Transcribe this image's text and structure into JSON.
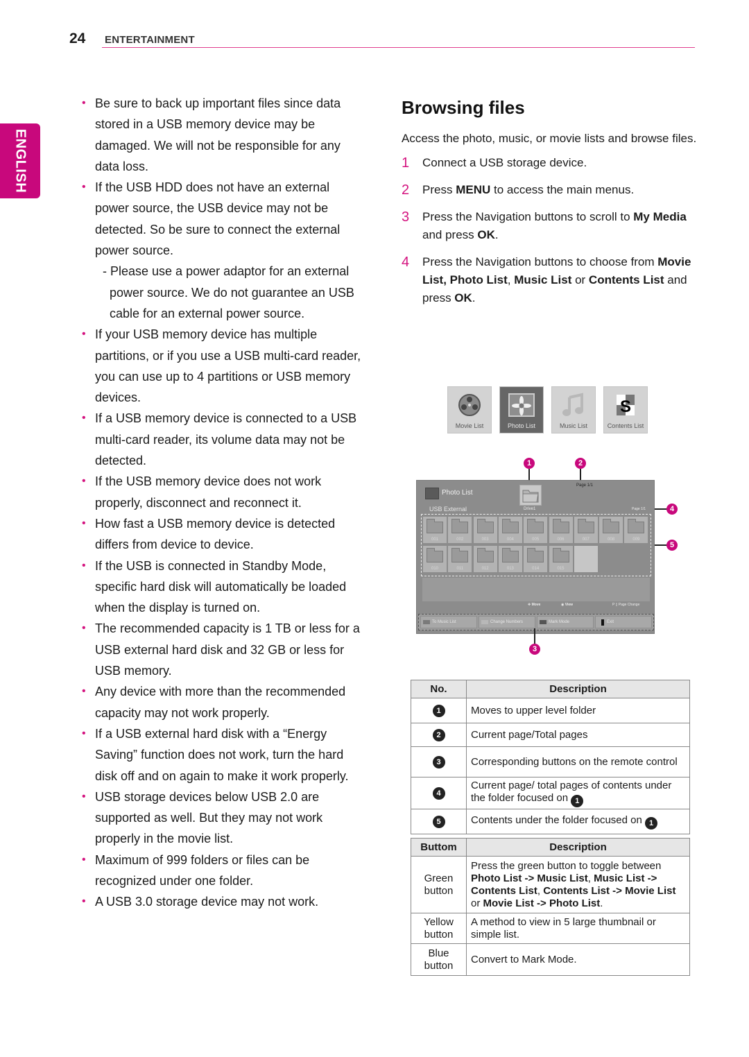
{
  "header": {
    "page_number": "24",
    "section": "ENTERTAINMENT"
  },
  "language_tab": "ENGLISH",
  "notes": [
    "Be sure to back up important files since data stored in a USB memory device may be damaged. We will not be responsible for any data loss.",
    "If the USB HDD does not have an external power source, the USB device may not be detected. So be sure to connect the external power source.",
    "If your USB memory device has multiple partitions, or if you use a USB multi-card reader, you can use up to 4 partitions or USB memory devices.",
    "If a USB memory device is connected to a USB multi-card reader, its volume data may not be detected.",
    "If the USB memory device does not work properly, disconnect and reconnect it.",
    "How fast a USB memory device is detected differs from device to device.",
    "If the USB is connected in Standby Mode, specific hard disk will automatically be loaded when the display is turned on.",
    "The recommended capacity is 1 TB or less for a USB external hard disk and 32 GB or less for USB memory.",
    "Any device with more than the recommended capacity may not work properly.",
    "If a USB external hard disk with a “Energy Saving” function does not work, turn the hard disk off and on again to make it work properly.",
    "USB storage devices below USB 2.0 are supported as well. But they may not work properly in the movie list.",
    "Maximum of 999 folders or files can be recognized under one folder.",
    "A USB 3.0 storage device may not work."
  ],
  "sub_note": "- Please use a power adaptor for an external power source. We do not guarantee an USB cable for an external power source.",
  "section_title": "Browsing files",
  "intro": "Access the photo, music, or movie lists and browse files.",
  "steps": [
    {
      "num": "1",
      "parts": [
        [
          "Connect a USB storage device.",
          false
        ]
      ]
    },
    {
      "num": "2",
      "parts": [
        [
          "Press ",
          false
        ],
        [
          "MENU",
          true
        ],
        [
          " to access the main menus.",
          false
        ]
      ]
    },
    {
      "num": "3",
      "parts": [
        [
          "Press the Navigation buttons to scroll to ",
          false
        ],
        [
          "My Media",
          true
        ],
        [
          " and press ",
          false
        ],
        [
          "OK",
          true
        ],
        [
          ".",
          false
        ]
      ]
    },
    {
      "num": "4",
      "parts": [
        [
          "Press the Navigation buttons to choose from ",
          false
        ],
        [
          "Movie List, Photo List",
          true
        ],
        [
          ", ",
          false
        ],
        [
          "Music List",
          true
        ],
        [
          " or ",
          false
        ],
        [
          "Contents List",
          true
        ],
        [
          " and press ",
          false
        ],
        [
          "OK",
          true
        ],
        [
          ".",
          false
        ]
      ]
    }
  ],
  "media_menu": [
    {
      "label": "Movie List",
      "icon": "film-reel-icon",
      "active": false
    },
    {
      "label": "Photo List",
      "icon": "photo-flower-icon",
      "active": true
    },
    {
      "label": "Music List",
      "icon": "music-note-icon",
      "active": false
    },
    {
      "label": "Contents List",
      "icon": "contents-s-icon",
      "active": false
    }
  ],
  "screen": {
    "title": "Photo List",
    "source": "USB External",
    "drive": "Drive1",
    "page_top": "Page 1/1",
    "page_right": "Page 1/1",
    "folders": [
      "001",
      "002",
      "003",
      "004",
      "005",
      "006",
      "007",
      "008",
      "009",
      "010",
      "011",
      "012",
      "013",
      "014",
      "015"
    ],
    "hints": {
      "move": "Move",
      "view": "View",
      "page_change": "P ▯ Page Change"
    },
    "buttons": [
      {
        "label": "To Music List",
        "color": "#7a7a7a"
      },
      {
        "label": "Change Numbers",
        "color": "#b8b8b8"
      },
      {
        "label": "Mark Mode",
        "color": "#555555"
      },
      {
        "label": "Exit",
        "color": "#111111"
      }
    ]
  },
  "callouts": [
    "1",
    "2",
    "3",
    "4",
    "5"
  ],
  "table1": {
    "headers": [
      "No.",
      "Description"
    ],
    "rows": [
      {
        "no": "1",
        "desc": "Moves to upper level folder"
      },
      {
        "no": "2",
        "desc": "Current page/Total pages"
      },
      {
        "no": "3",
        "desc": "Corresponding buttons on the remote control"
      },
      {
        "no": "4",
        "desc": "Current page/ total pages of contents under the folder focused on",
        "ref": "1"
      },
      {
        "no": "5",
        "desc": "Contents under the folder focused on",
        "ref": "1"
      }
    ]
  },
  "table2": {
    "headers": [
      "Buttom",
      "Description"
    ],
    "rows": [
      {
        "button": "Green button",
        "parts": [
          [
            "Press the green button to toggle between ",
            false
          ],
          [
            "Photo List -> Music List",
            true
          ],
          [
            ", ",
            false
          ],
          [
            "Music List -> Contents List",
            true
          ],
          [
            ", ",
            false
          ],
          [
            "Contents List -> Movie List",
            true
          ],
          [
            " or ",
            false
          ],
          [
            "Movie List -> Photo List",
            true
          ],
          [
            ".",
            false
          ]
        ]
      },
      {
        "button": "Yellow button",
        "parts": [
          [
            "A method to view in 5 large thumbnail or simple list.",
            false
          ]
        ]
      },
      {
        "button": "Blue button",
        "parts": [
          [
            "Convert to Mark Mode.",
            false
          ]
        ]
      }
    ]
  },
  "colors": {
    "accent": "#c8087c",
    "rule": "#e03c8e"
  }
}
